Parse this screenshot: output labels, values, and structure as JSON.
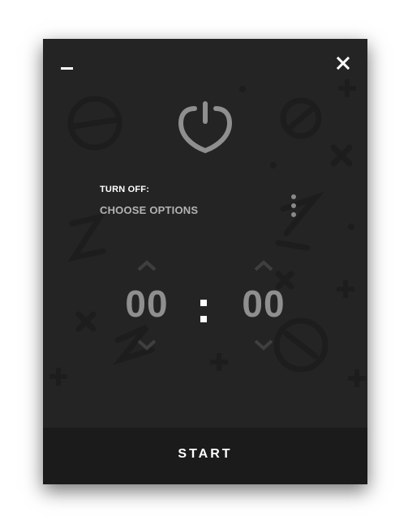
{
  "window": {
    "minimize_icon": "minus-icon",
    "close_icon": "close-icon",
    "power_icon": "power-shield-icon",
    "turn_off_label": "TURN OFF:",
    "choose_options": "CHOOSE OPTIONS",
    "more_icon": "vertical-dots-icon"
  },
  "timer": {
    "hours": "00",
    "separator": ":",
    "minutes": "00",
    "up_icon": "chevron-up-icon",
    "down_icon": "chevron-down-icon"
  },
  "footer": {
    "start_label": "START"
  },
  "colors": {
    "window_bg": "#242424",
    "footer_bg": "#1b1b1b",
    "accent_gray": "#8f8f8f",
    "text_white": "#ffffff"
  }
}
